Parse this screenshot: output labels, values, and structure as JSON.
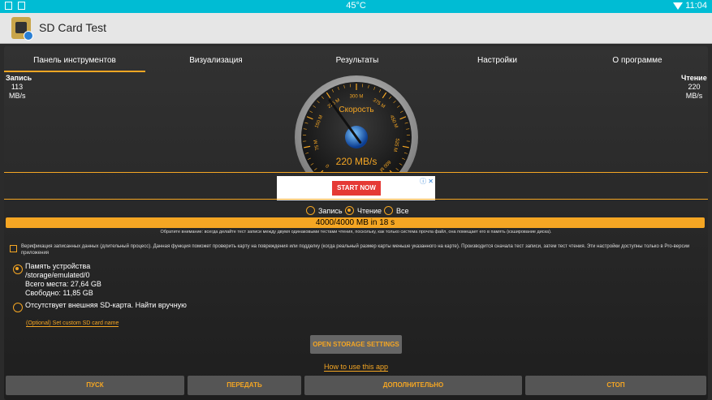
{
  "statusbar": {
    "temperature": "45°C",
    "time": "11:04"
  },
  "app": {
    "title": "SD Card Test"
  },
  "tabs": [
    {
      "label": "Панель инструментов",
      "active": true
    },
    {
      "label": "Визуализация",
      "active": false
    },
    {
      "label": "Результаты",
      "active": false
    },
    {
      "label": "Настройки",
      "active": false
    },
    {
      "label": "О программе",
      "active": false
    }
  ],
  "write_stat": {
    "label": "Запись",
    "value": "113",
    "unit": "MB/s"
  },
  "read_stat": {
    "label": "Чтение",
    "value": "220",
    "unit": "MB/s"
  },
  "gauge": {
    "title": "Скорость",
    "reading": "220 MB/s",
    "tick_labels": [
      "0",
      "75 M",
      "150 M",
      "225 M",
      "300 M",
      "375 M",
      "450 M",
      "525 M",
      "600 M"
    ],
    "value_mbs": 220,
    "max_mbs": 600
  },
  "ad": {
    "button_label": "START NOW",
    "close_label": "ⓘ ✕"
  },
  "mode_options": [
    {
      "label": "Запись",
      "selected": false
    },
    {
      "label": "Чтение",
      "selected": true
    },
    {
      "label": "Все",
      "selected": false
    }
  ],
  "progress": {
    "text": "4000/4000 MB in 18 s",
    "fraction": 1.0
  },
  "notice": "Обратите внимание: всегда делайте тест записи между двумя одинаковыми тестами чтения, поскольку, как только система прочла файл, она помещает его в память (кэширование диска).",
  "verification": {
    "checked": false,
    "text": "Верификация записанных данных (длительный процесс). Данная функция поможет проверить карту на повреждения или подделку (когда реальный размер карты меньше указанного на карте). Производится сначала тест записи, затем тест чтения. Эти настройки доступны только в Pro-версии приложения"
  },
  "storage_internal": {
    "name": "Память устройства",
    "path": "/storage/emulated/0",
    "total": "Всего места: 27,64 GB",
    "free": "Свободно: 11,85 GB",
    "selected": true
  },
  "storage_external": {
    "name": "Отсутствует внешняя SD-карта. Найти вручную",
    "selected": false
  },
  "custom_name_link": "(Optional) Set custom SD card name",
  "open_storage_button": "OPEN STORAGE SETTINGS",
  "howto_link": "How to use this app",
  "bottom_buttons": [
    "ПУСК",
    "ПЕРЕДАТЬ",
    "ДОПОЛНИТЕЛЬНО",
    "СТОП"
  ],
  "colors": {
    "accent": "#f5a623",
    "statusbar": "#00bcd4",
    "appbar": "#e6e6e6",
    "background": "#2b2b2b"
  }
}
